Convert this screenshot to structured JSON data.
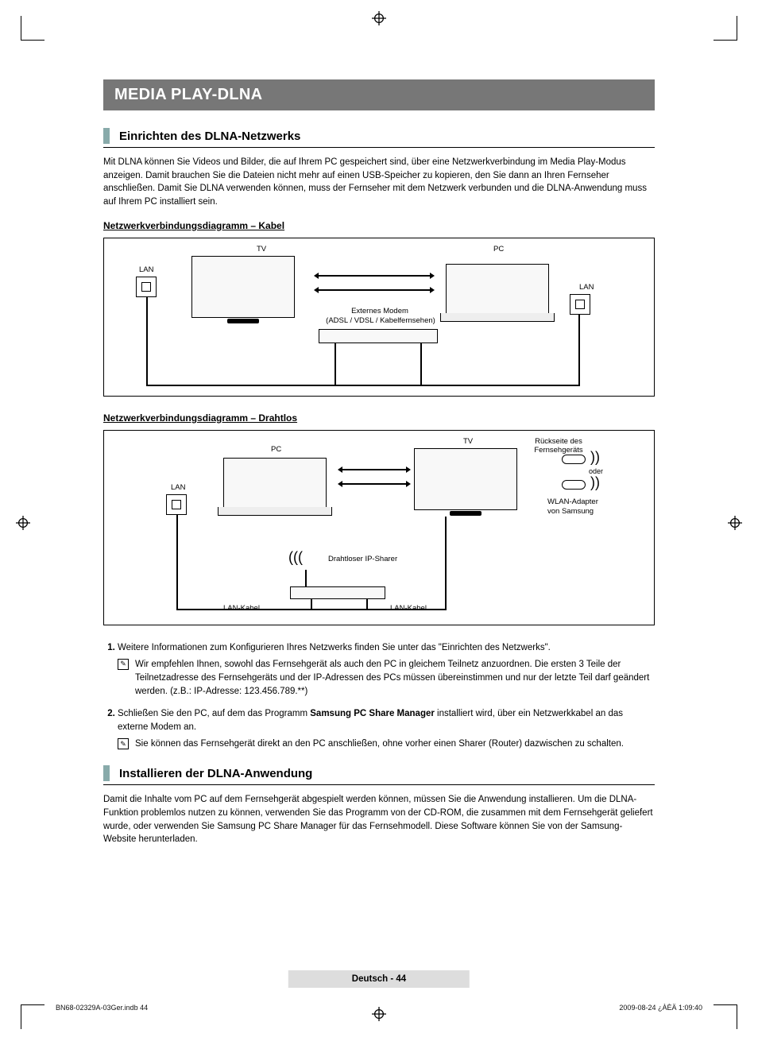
{
  "title": "MEDIA PLAY-DLNA",
  "section1": {
    "heading": "Einrichten des DLNA-Netzwerks",
    "intro": "Mit DLNA können Sie Videos und Bilder, die auf Ihrem PC gespeichert sind, über eine Netzwerkverbindung im Media Play-Modus anzeigen. Damit brauchen Sie die Dateien nicht mehr auf einen USB-Speicher zu kopieren, den Sie dann an Ihren Fernseher anschließen. Damit Sie DLNA verwenden können, muss der Fernseher mit dem Netzwerk verbunden und die DLNA-Anwendung muss auf Ihrem PC installiert sein.",
    "sub1": "Netzwerkverbindungsdiagramm – Kabel",
    "sub2": "Netzwerkverbindungsdiagramm – Drahtlos"
  },
  "diagram1": {
    "tv": "TV",
    "pc": "PC",
    "lan": "LAN",
    "modem_line1": "Externes Modem",
    "modem_line2": "(ADSL / VDSL / Kabelfernsehen)"
  },
  "diagram2": {
    "tv": "TV",
    "pc": "PC",
    "lan": "LAN",
    "back": "Rückseite des Fernsehgeräts",
    "oder": "oder",
    "adapter1": "WLAN-Adapter",
    "adapter2": "von Samsung",
    "sharer": "Drahtloser IP-Sharer",
    "lankabel": "LAN-Kabel"
  },
  "list": {
    "item1": "Weitere Informationen zum Konfigurieren Ihres Netzwerks finden Sie unter das \"Einrichten des Netzwerks\".",
    "note1": "Wir empfehlen Ihnen, sowohl das Fernsehgerät als auch den PC in gleichem Teilnetz anzuordnen. Die ersten 3 Teile der Teilnetzadresse des Fernsehgeräts und der IP-Adressen des PCs müssen übereinstimmen und nur der letzte Teil darf geändert werden. (z.B.: IP-Adresse: 123.456.789.**)",
    "item2a": "Schließen Sie den PC, auf dem das Programm ",
    "item2b": "Samsung PC Share Manager",
    "item2c": " installiert wird, über ein Netzwerkkabel an das externe Modem an.",
    "note2": "Sie können das Fernsehgerät direkt an den PC anschließen, ohne vorher einen Sharer (Router) dazwischen zu schalten."
  },
  "section2": {
    "heading": "Installieren der DLNA-Anwendung",
    "intro": "Damit die Inhalte vom PC auf dem Fernsehgerät abgespielt werden können, müssen Sie die Anwendung installieren. Um die DLNA-Funktion problemlos nutzen zu können, verwenden Sie das Programm von der CD-ROM, die zusammen mit dem Fernsehgerät geliefert wurde, oder verwenden Sie Samsung PC Share Manager für das Fernsehmodell. Diese Software können Sie von der Samsung-Website herunterladen."
  },
  "footer": {
    "center": "Deutsch - 44",
    "left": "BN68-02329A-03Ger.indb   44",
    "right": "2009-08-24   ¿ÀÈÄ 1:09:40"
  }
}
